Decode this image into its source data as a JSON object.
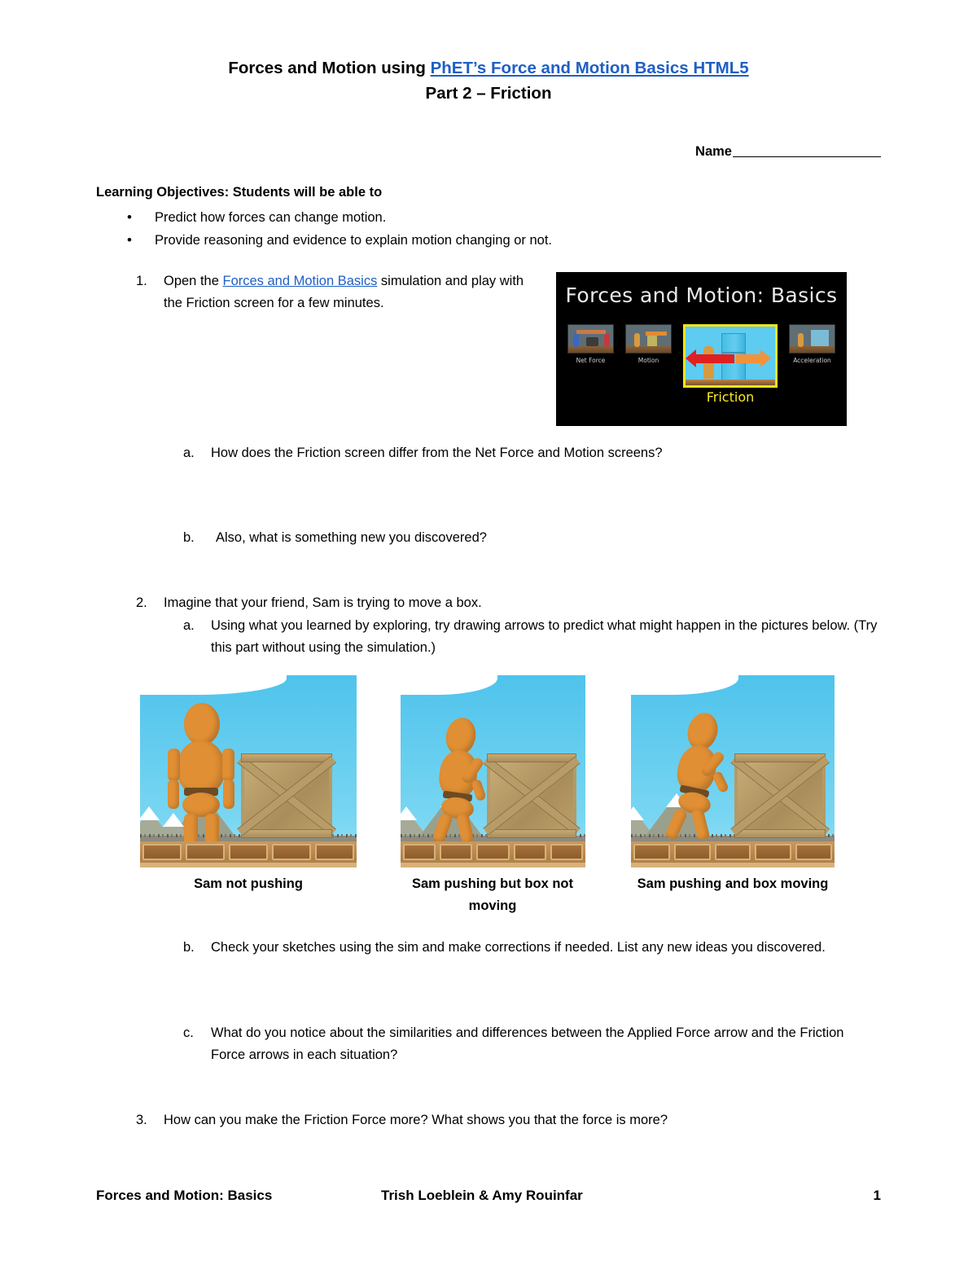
{
  "document": {
    "title_prefix": "Forces and Motion using ",
    "title_link": "PhET’s Force and Motion Basics HTML5",
    "subtitle": "Part 2 – Friction",
    "name_label": "Name",
    "link_color": "#1F5FC4"
  },
  "objectives": {
    "heading": "Learning Objectives: Students will be able to",
    "items": [
      "Predict how forces can change motion.",
      "Provide reasoning and evidence to explain motion changing or not."
    ],
    "bullet": "•"
  },
  "questions": {
    "q1": {
      "marker": "1.",
      "text_before": "Open the ",
      "link": "Forces and Motion Basics",
      "text_after": " simulation and play with the Friction screen for a few minutes."
    },
    "q1a": {
      "marker": "a.",
      "text": "How does the Friction screen differ from the Net Force and Motion screens?"
    },
    "q1b": {
      "marker": "b.",
      "text": "Also, what is something new you discovered?"
    },
    "q2": {
      "marker": "2.",
      "text": "Imagine that your friend, Sam is trying to move a box."
    },
    "q2a": {
      "marker": "a.",
      "text": "Using what you learned by exploring, try drawing arrows to predict what might happen in the pictures below. (Try this part without using the simulation.)"
    },
    "q2b": {
      "marker": "b.",
      "text": "Check your sketches using the sim and make corrections if needed. List any new ideas you discovered."
    },
    "q2c": {
      "marker": "c.",
      "text": "What do you notice about the similarities and differences between the Applied Force arrow and the Friction Force arrows in each situation?"
    },
    "q3": {
      "marker": "3.",
      "text": "How can you make the Friction Force more?  What shows you that the force is more?"
    }
  },
  "phet_thumbnail": {
    "title": "Forces and Motion: Basics",
    "screens": [
      {
        "label": "Net Force",
        "active": false
      },
      {
        "label": "Motion",
        "active": false
      },
      {
        "label": "Friction",
        "active": true
      },
      {
        "label": "Acceleration",
        "active": false
      }
    ],
    "highlight_color": "#F2E41C",
    "background_color": "#000000"
  },
  "scenes": [
    {
      "caption": "Sam not pushing"
    },
    {
      "caption": "Sam pushing but box not moving"
    },
    {
      "caption": "Sam pushing and box moving"
    }
  ],
  "footer": {
    "left": "Forces and Motion: Basics",
    "middle": "Trish Loeblein & Amy Rouinfar",
    "page_number": "1"
  }
}
